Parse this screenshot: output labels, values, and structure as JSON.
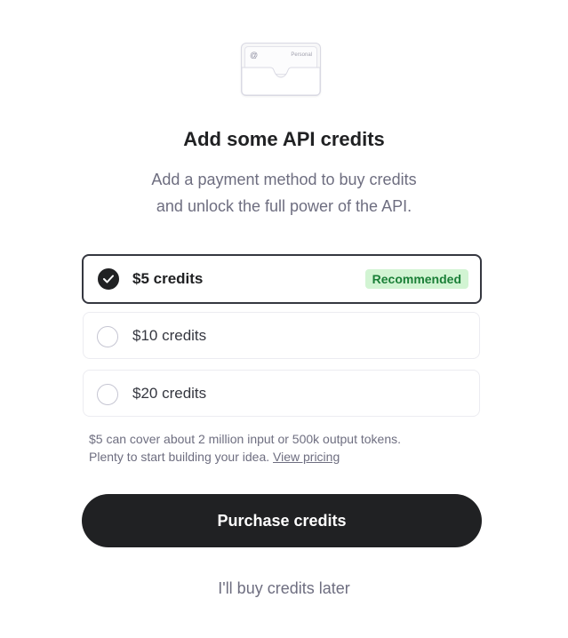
{
  "illustration": {
    "icon": "wallet-icon",
    "card_symbol": "@",
    "card_label": "Personal"
  },
  "header": {
    "title": "Add some API credits",
    "subtitle_line1": "Add a payment method to buy credits",
    "subtitle_line2": "and unlock the full power of the API."
  },
  "options": [
    {
      "label": "$5 credits",
      "selected": true,
      "badge": "Recommended"
    },
    {
      "label": "$10 credits",
      "selected": false
    },
    {
      "label": "$20 credits",
      "selected": false
    }
  ],
  "note": {
    "line1": "$5 can cover about 2 million input or 500k output tokens.",
    "line2": "Plenty to start building your idea.",
    "link": "View pricing"
  },
  "actions": {
    "purchase": "Purchase credits",
    "later": "I'll buy credits later"
  },
  "colors": {
    "primary": "#202123",
    "muted_text": "#6e6e80",
    "badge_bg": "#d2f4d3",
    "badge_text": "#1a7f37",
    "border": "#ececf1"
  }
}
